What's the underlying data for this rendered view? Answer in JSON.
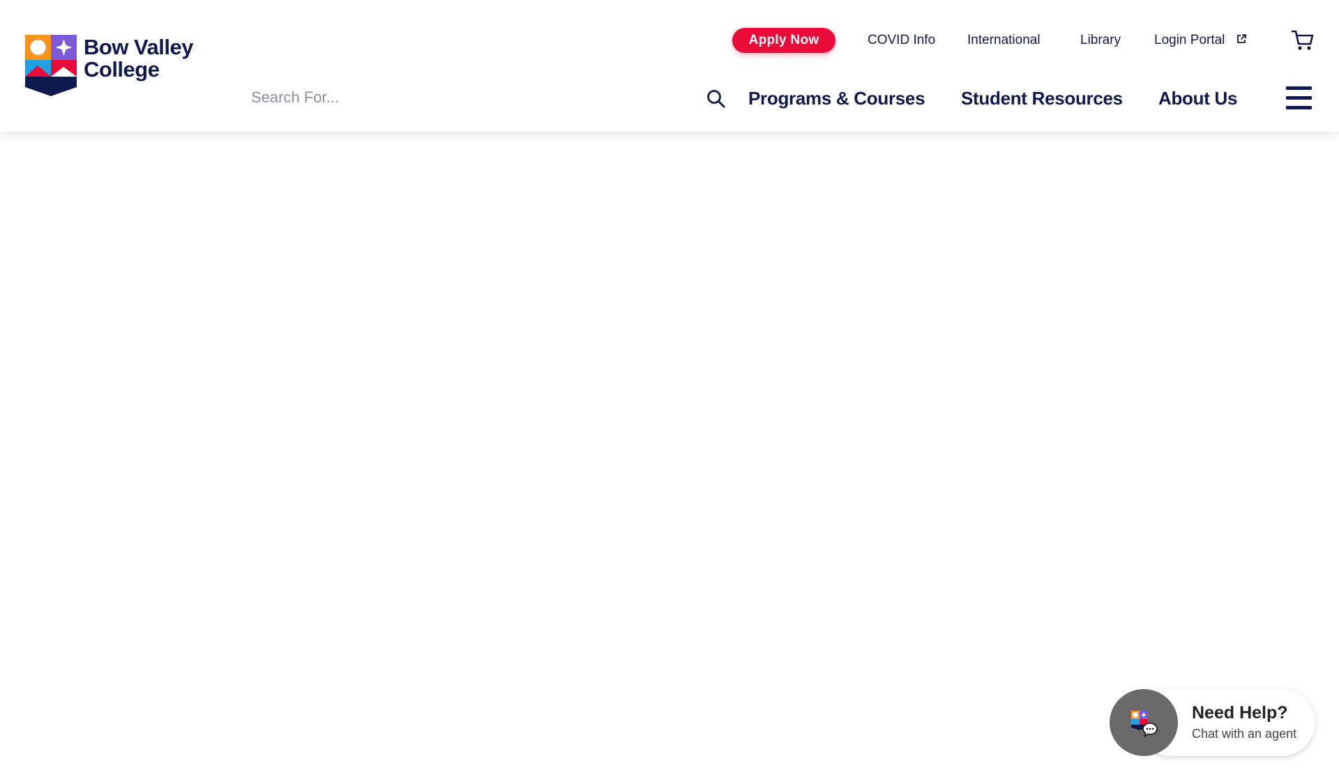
{
  "brand": {
    "line1": "Bow Valley",
    "line2": "College",
    "colors": {
      "navy": "#10194e",
      "orange": "#f7941d",
      "purple": "#7b5cd6",
      "blue": "#1fa0e0",
      "red": "#ea0b3a"
    }
  },
  "utility_nav": {
    "apply_label": "Apply Now",
    "links": [
      "COVID Info",
      "International",
      "Library",
      "Login Portal"
    ]
  },
  "search": {
    "placeholder": "Search For..."
  },
  "main_nav": {
    "items": [
      "Programs & Courses",
      "Student Resources",
      "About Us"
    ]
  },
  "chat": {
    "title": "Need Help?",
    "subtitle": "Chat with an agent"
  },
  "icons": [
    "external-link-icon",
    "cart-icon",
    "search-icon",
    "hamburger-menu-icon",
    "chat-bubble-icon"
  ]
}
